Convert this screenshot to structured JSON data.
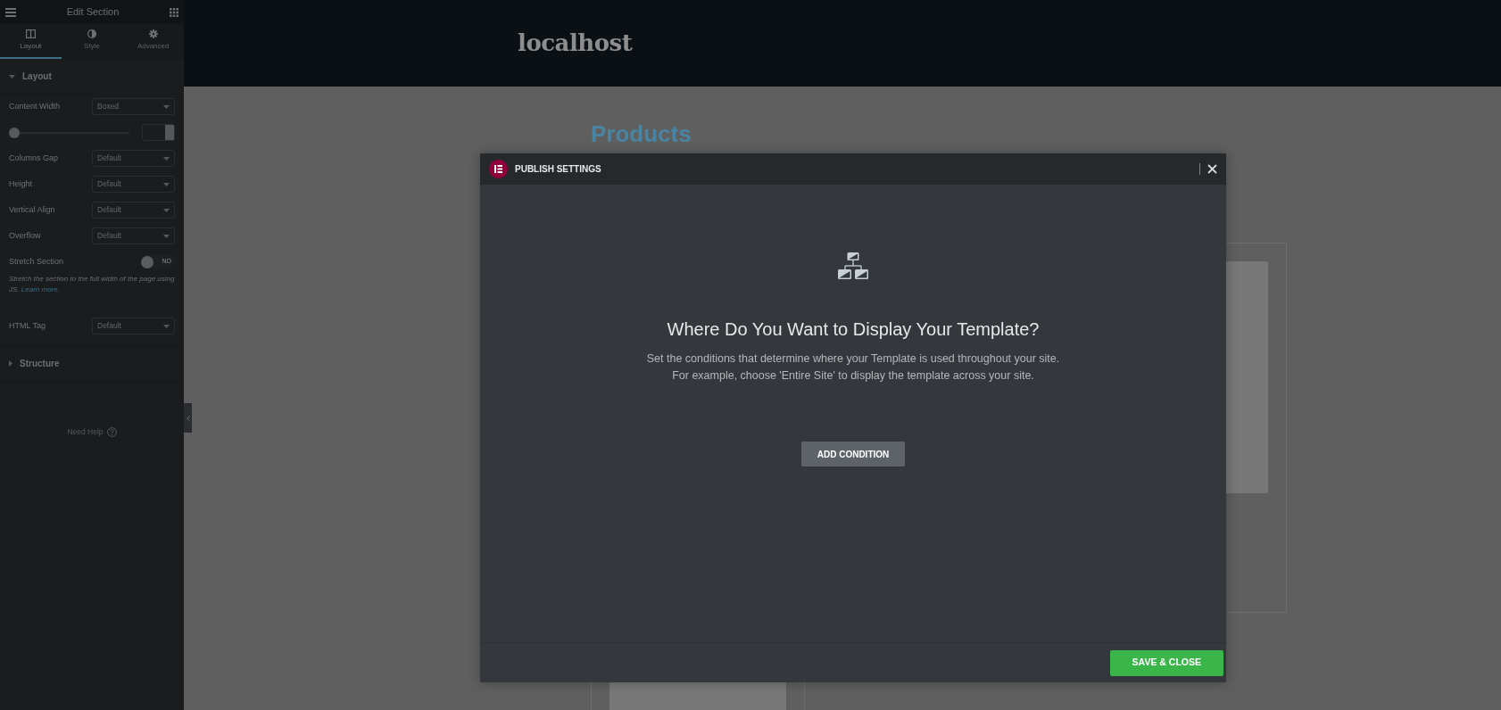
{
  "sidebar": {
    "title": "Edit Section",
    "tabs": [
      {
        "label": "Layout",
        "selected": true
      },
      {
        "label": "Style",
        "selected": false
      },
      {
        "label": "Advanced",
        "selected": false
      }
    ],
    "sections": [
      {
        "title": "Layout",
        "expanded": true,
        "controls": [
          {
            "kind": "select",
            "label": "Content Width",
            "value": "Boxed"
          },
          {
            "kind": "slider",
            "level": 0
          },
          {
            "kind": "select",
            "label": "Columns Gap",
            "value": "Default"
          },
          {
            "kind": "select",
            "label": "Height",
            "value": "Default"
          },
          {
            "kind": "select",
            "label": "Vertical Align",
            "value": "Default"
          },
          {
            "kind": "select",
            "label": "Overflow",
            "value": "Default"
          },
          {
            "kind": "switch",
            "label": "Stretch Section",
            "on": false,
            "switch_text": "NO"
          },
          {
            "kind": "note",
            "text": "Stretch the section to the full width of the page using JS.",
            "link": "Learn more."
          },
          {
            "kind": "select",
            "label": "HTML Tag",
            "value": "Default"
          }
        ]
      },
      {
        "title": "Structure",
        "expanded": false
      }
    ],
    "help": "Need Help"
  },
  "site": {
    "title": "localhost",
    "heading": "Products"
  },
  "modal": {
    "title": "PUBLISH SETTINGS",
    "heading": "Where Do You Want to Display Your Template?",
    "description": [
      "Set the conditions that determine where your Template is used throughout your site.",
      "For example, choose 'Entire Site' to display the template across your site."
    ],
    "add_button": "ADD CONDITION",
    "save_button": "SAVE & CLOSE"
  }
}
